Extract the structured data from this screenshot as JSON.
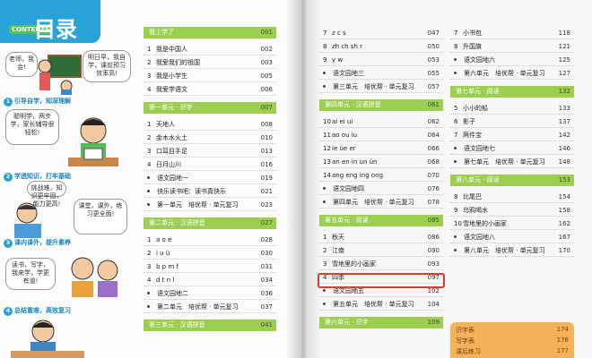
{
  "header": {
    "badge": "CONTENTS",
    "title": "目录"
  },
  "illustration": {
    "bubbles": [
      "老师，我会!",
      "明日早，我自学，课前预习效率高!",
      "聪明学，两步学，家长辅导很轻松!",
      "挑战难，知识更牢固，能力更高!",
      "课堂，课外，练习更全面!",
      "读书，写字，我来学，学更有道!"
    ],
    "steps": [
      {
        "num": "1",
        "label": "引导自学，知深理解"
      },
      {
        "num": "2",
        "label": "学透知识，打牢基础"
      },
      {
        "num": "3",
        "label": "课内课外，提升素养"
      },
      {
        "num": "4",
        "label": "总结重难，高效复习"
      }
    ]
  },
  "columns": {
    "a": {
      "sections": [
        {
          "title": "我上学了",
          "page": "001",
          "entries": [
            {
              "n": "1",
              "t": "我是中国人",
              "pg": "002"
            },
            {
              "n": "2",
              "t": "我爱我们的祖国",
              "pg": "003"
            },
            {
              "n": "3",
              "t": "我是小学生",
              "pg": "005"
            },
            {
              "n": "4",
              "t": "我爱学语文",
              "pg": "006"
            }
          ]
        },
        {
          "title": "第一单元 · 识字",
          "page": "007",
          "entries": [
            {
              "n": "1",
              "t": "天地人",
              "pg": "008"
            },
            {
              "n": "2",
              "t": "金木水火土",
              "pg": "010"
            },
            {
              "n": "3",
              "t": "口耳目手足",
              "pg": "013"
            },
            {
              "n": "4",
              "t": "日月山川",
              "pg": "016"
            },
            {
              "n": "",
              "t": "语文园地一",
              "pg": "019"
            },
            {
              "n": "",
              "t": "快乐读书吧：读书真快乐",
              "pg": "021"
            },
            {
              "n": "",
              "t": "第一单元　培优帮 · 单元复习",
              "pg": "023"
            }
          ]
        },
        {
          "title": "第二单元 · 汉语拼音",
          "page": "027",
          "entries": [
            {
              "n": "1",
              "t": "a o e",
              "pg": "028"
            },
            {
              "n": "2",
              "t": "i u ü",
              "pg": "030"
            },
            {
              "n": "3",
              "t": "b p m f",
              "pg": "031"
            },
            {
              "n": "4",
              "t": "d t n l",
              "pg": "034"
            },
            {
              "n": "",
              "t": "语文园地二",
              "pg": "036"
            },
            {
              "n": "",
              "t": "第二单元　培优帮 · 单元复习",
              "pg": "037"
            }
          ]
        },
        {
          "title": "第三单元 · 汉语拼音",
          "page": "041",
          "entries": []
        }
      ]
    },
    "b": {
      "sections": [
        {
          "title": "",
          "page": "",
          "entries": [
            {
              "n": "7",
              "t": "z c s",
              "pg": "047"
            },
            {
              "n": "8",
              "t": "zh ch sh r",
              "pg": "050"
            },
            {
              "n": "9",
              "t": "y w",
              "pg": "053"
            },
            {
              "n": "",
              "t": "语文园地三",
              "pg": "055"
            },
            {
              "n": "",
              "t": "第三单元　培优帮 · 单元复习",
              "pg": "057"
            }
          ]
        },
        {
          "title": "第四单元 · 汉语拼音",
          "page": "061",
          "entries": [
            {
              "n": "10",
              "t": "ai ei ui",
              "pg": "062"
            },
            {
              "n": "11",
              "t": "ao ou iu",
              "pg": "064"
            },
            {
              "n": "12",
              "t": "ie üe er",
              "pg": "066"
            },
            {
              "n": "13",
              "t": "an en in un ün",
              "pg": "068"
            },
            {
              "n": "14",
              "t": "ang eng ing ong",
              "pg": "070"
            },
            {
              "n": "",
              "t": "语文园地四",
              "pg": "076"
            },
            {
              "n": "",
              "t": "第四单元　培优帮 · 单元复习",
              "pg": "078"
            }
          ]
        },
        {
          "title": "第五单元 · 阅读",
          "page": "085",
          "entries": [
            {
              "n": "1",
              "t": "秋天",
              "pg": "086"
            },
            {
              "n": "2",
              "t": "江南",
              "pg": "090"
            },
            {
              "n": "3",
              "t": "雪地里的小画家",
              "pg": "093"
            },
            {
              "n": "4",
              "t": "四季",
              "pg": "097"
            },
            {
              "n": "",
              "t": "语文园地五",
              "pg": "102"
            },
            {
              "n": "",
              "t": "第五单元　培优帮 · 单元复习",
              "pg": "104"
            }
          ]
        },
        {
          "title": "第六单元 · 识字",
          "page": "109",
          "entries": []
        }
      ]
    },
    "c": {
      "sections": [
        {
          "title": "",
          "page": "",
          "entries": [
            {
              "n": "7",
              "t": "小书包",
              "pg": "118"
            },
            {
              "n": "8",
              "t": "升国旗",
              "pg": "121"
            },
            {
              "n": "",
              "t": "语文园地六",
              "pg": "125"
            },
            {
              "n": "",
              "t": "第六单元　培优帮 · 单元复习",
              "pg": "127"
            }
          ]
        },
        {
          "title": "第七单元 · 阅读",
          "page": "132",
          "entries": [
            {
              "n": "5",
              "t": "小小的船",
              "pg": "133"
            },
            {
              "n": "6",
              "t": "影子",
              "pg": "137"
            },
            {
              "n": "7",
              "t": "两件宝",
              "pg": "142"
            },
            {
              "n": "",
              "t": "语文园地七",
              "pg": "146"
            },
            {
              "n": "",
              "t": "第七单元　培优帮 · 单元复习",
              "pg": "148"
            }
          ]
        },
        {
          "title": "第八单元 · 阅读",
          "page": "153",
          "entries": [
            {
              "n": "8",
              "t": "比尾巴",
              "pg": "154"
            },
            {
              "n": "9",
              "t": "乌鸦喝水",
              "pg": "158"
            },
            {
              "n": "10",
              "t": "雪地里的小画家",
              "pg": "162"
            },
            {
              "n": "",
              "t": "语文园地八",
              "pg": "167"
            },
            {
              "n": "",
              "t": "第八单元　培优帮 · 单元复习",
              "pg": "170"
            }
          ]
        }
      ],
      "tabs": [
        {
          "t": "识字表",
          "pg": "174"
        },
        {
          "t": "写字表",
          "pg": "176"
        },
        {
          "t": "课后练习",
          "pg": "177"
        }
      ]
    }
  },
  "highlight_entry": "雪地里的小画家"
}
